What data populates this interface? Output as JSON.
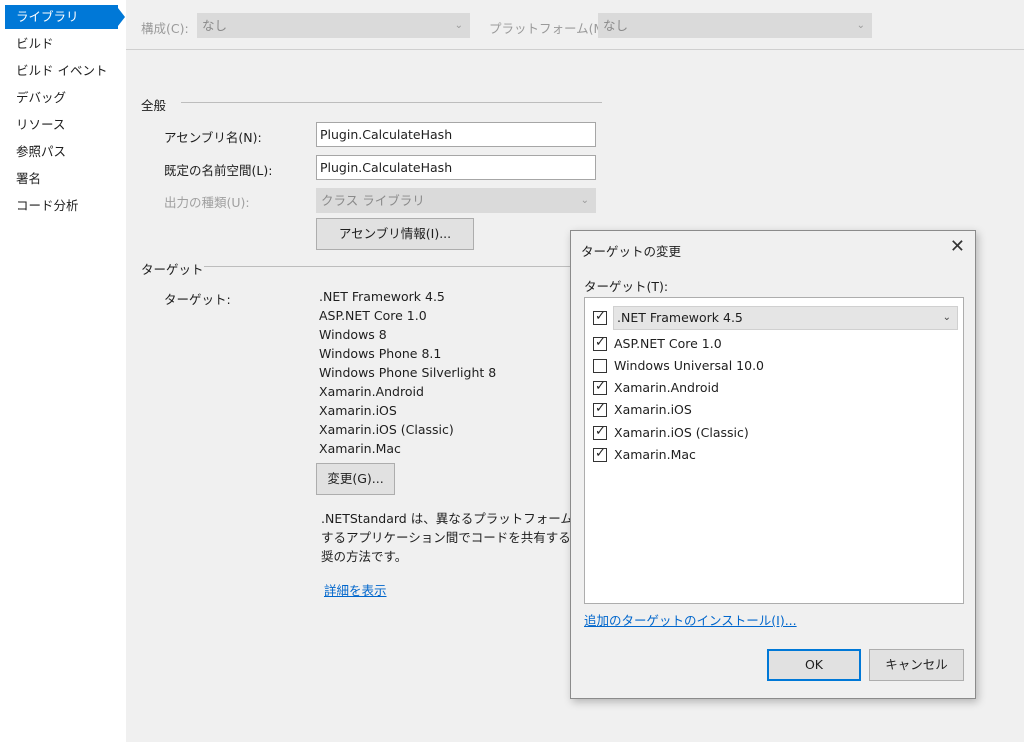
{
  "sidebar": {
    "items": [
      {
        "label": "ライブラリ",
        "active": true
      },
      {
        "label": "ビルド"
      },
      {
        "label": "ビルド イベント"
      },
      {
        "label": "デバッグ"
      },
      {
        "label": "リソース"
      },
      {
        "label": "参照パス"
      },
      {
        "label": "署名"
      },
      {
        "label": "コード分析"
      }
    ]
  },
  "config": {
    "configuration_label": "構成(C):",
    "configuration_value": "なし",
    "platform_label": "プラットフォーム(M):",
    "platform_value": "なし"
  },
  "general": {
    "header": "全般",
    "assembly_name_label": "アセンブリ名(N):",
    "assembly_name_value": "Plugin.CalculateHash",
    "default_namespace_label": "既定の名前空間(L):",
    "default_namespace_value": "Plugin.CalculateHash",
    "output_type_label": "出力の種類(U):",
    "output_type_value": "クラス ライブラリ",
    "assembly_info_button": "アセンブリ情報(I)..."
  },
  "target": {
    "header": "ターゲット",
    "label": "ターゲット:",
    "items": [
      ".NET Framework 4.5",
      "ASP.NET Core 1.0",
      "Windows 8",
      "Windows Phone 8.1",
      "Windows Phone Silverlight 8",
      "Xamarin.Android",
      "Xamarin.iOS",
      "Xamarin.iOS (Classic)",
      "Xamarin.Mac"
    ],
    "change_button": "変更(G)...",
    "description_lines": [
      ".NETStandard は、異なるプラットフォームを対象",
      "するアプリケーション間でコードを共有するための",
      "奨の方法です。"
    ],
    "details_link": "詳細を表示"
  },
  "dialog": {
    "title": "ターゲットの変更",
    "close_icon": "close-icon",
    "targets_label": "ターゲット(T):",
    "framework_value": ".NET Framework 4.5",
    "framework_checked": true,
    "options": [
      {
        "label": "ASP.NET Core 1.0",
        "checked": true
      },
      {
        "label": "Windows Universal 10.0",
        "checked": false
      },
      {
        "label": "Xamarin.Android",
        "checked": true
      },
      {
        "label": "Xamarin.iOS",
        "checked": true
      },
      {
        "label": "Xamarin.iOS (Classic)",
        "checked": true
      },
      {
        "label": "Xamarin.Mac",
        "checked": true
      }
    ],
    "install_link": "追加のターゲットのインストール(I)...",
    "ok_button": "OK",
    "cancel_button": "キャンセル"
  },
  "colors": {
    "accent": "#0078d7",
    "link": "#0066cc"
  }
}
